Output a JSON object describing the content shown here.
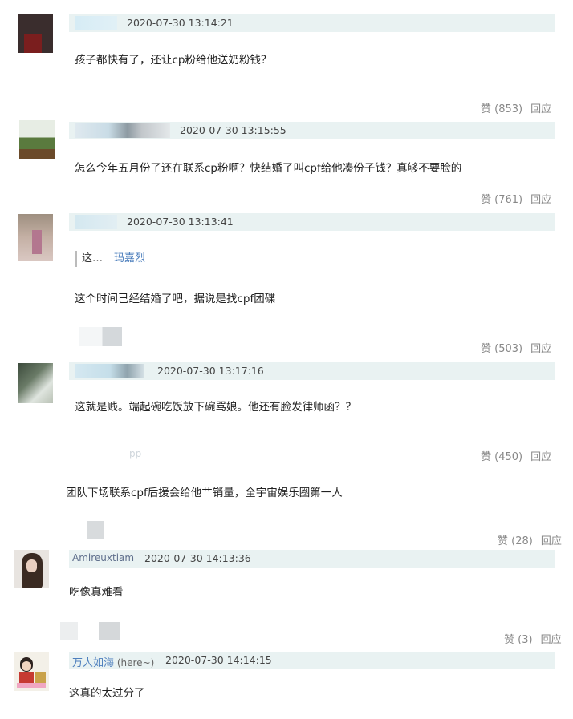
{
  "comments": [
    {
      "timestamp": "2020-07-30 13:14:21",
      "text": "孩子都快有了，还让cp粉给他送奶粉钱？",
      "likes": "赞 (853)",
      "reply": "回应"
    },
    {
      "timestamp": "2020-07-30 13:15:55",
      "text": "怎么今年五月份了还在联系cp粉啊？快结婚了叫cpf给他凑份子钱？真够不要脸的",
      "likes": "赞 (761)",
      "reply": "回应"
    },
    {
      "timestamp": "2020-07-30 13:13:41",
      "quote_text": "这…",
      "quote_name": "玛嘉烈",
      "text": "这个时间已经结婚了吧，据说是找cpf团碟",
      "likes": "赞 (503)",
      "reply": "回应"
    },
    {
      "timestamp": "2020-07-30 13:17:16",
      "text": "这就是贱。端起碗吃饭放下碗骂娘。他还有脸发律师函？？",
      "faded_label": "pp",
      "likes": "赞 (450)",
      "reply": "回应"
    },
    {
      "text": "团队下场联系cpf后援会给他艹销量，全宇宙娱乐圈第一人",
      "likes": "赞 (28)",
      "reply": "回应"
    },
    {
      "username": "Amireuxtiam",
      "timestamp": "2020-07-30 14:13:36",
      "text": "吃像真难看",
      "likes": "赞 (3)",
      "reply": "回应"
    },
    {
      "username": "万人如海",
      "username_suffix": "(here~)",
      "timestamp": "2020-07-30 14:14:15",
      "text": "这真的太过分了"
    }
  ],
  "colors": {
    "header_bar": "#e9f2f2",
    "username": "#5f6f8c",
    "quote_name": "#4d7fbd",
    "action_text": "#888888"
  }
}
